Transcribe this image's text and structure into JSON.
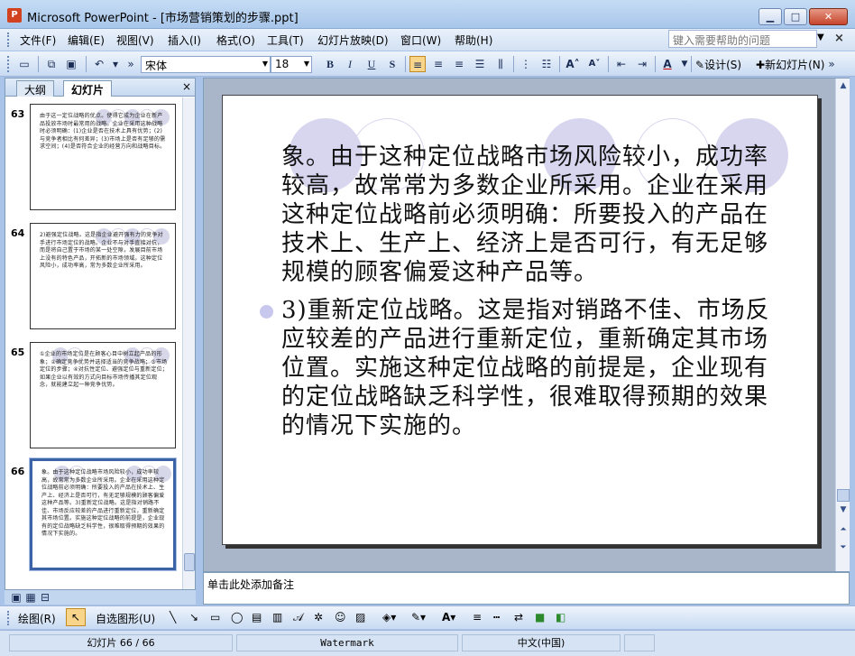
{
  "window": {
    "app_icon": "P",
    "title": "Microsoft PowerPoint - [市场营销策划的步骤.ppt]"
  },
  "window_controls": {
    "minimize": "▁",
    "maximize": "□",
    "close": "✕"
  },
  "menu": {
    "items": [
      "文件(F)",
      "编辑(E)",
      "视图(V)",
      "插入(I)",
      "格式(O)",
      "工具(T)",
      "幻灯片放映(D)",
      "窗口(W)",
      "帮助(H)"
    ],
    "help_placeholder": "键入需要帮助的问题"
  },
  "toolbar": {
    "font": "宋体",
    "size": "18",
    "bold": "B",
    "italic": "I",
    "underline": "U",
    "shadow": "S",
    "design": "设计(S)",
    "new_slide": "新幻灯片(N)"
  },
  "left_pane": {
    "tabs": [
      "大纲",
      "幻灯片"
    ],
    "close": "×",
    "thumbnails": [
      {
        "number": "63",
        "text": "由于这一定位战略的优点。使得它成为企业在新产品投放市场时最常用的战略。企业在采用这种战略时必须明确：(1)企业是否在技术上具有优势；(2)与竞争者相比有何差异；(3)市场上是否有足够的需求空间；(4)是否符合企业的经营方向和战略目标。"
      },
      {
        "number": "64",
        "text": "2)避强定位战略。这是指企业避开强有力的竞争对手进行市场定位的战略。企业不与对手直接对抗，而是将自己置于市场的某一处空隙，发展目前市场上没有的特色产品，开拓新的市场领域。这种定位风险小，成功率高，常为多数企业所采用。"
      },
      {
        "number": "65",
        "text": "①企业的市场定位是在顾客心目中树立起产品的形象；②确定竞争优势并选择适当的竞争战略；③市场定位的步骤；④对抗性定位、避强定位与重新定位；如果企业以有效的方式向目标市场传播其定位观念，就能建立起一种竞争优势。"
      },
      {
        "number": "66",
        "text": "象。由于这种定位战略市场风险较小，成功率较高，故常常为多数企业所采用。企业在采用这种定位战略前必须明确：所要投入的产品在技术上、生产上、经济上是否可行，有无足够规模的顾客偏爱这种产品等。3)重新定位战略。这是指对销路不佳、市场反应较差的产品进行重新定位，重新确定其市场位置。实施这种定位战略的前提是，企业现有的定位战略缺乏科学性，很难取得预期的效果的情况下实施的。"
      }
    ]
  },
  "slide": {
    "paragraph1": "象。由于这种定位战略市场风险较小，成功率较高，故常常为多数企业所采用。企业在采用这种定位战略前必须明确：所要投入的产品在技术上、生产上、经济上是否可行，有无足够规模的顾客偏爱这种产品等。",
    "paragraph2": "3)重新定位战略。这是指对销路不佳、市场反应较差的产品进行重新定位，重新确定其市场位置。实施这种定位战略的前提是，企业现有的定位战略缺乏科学性，很难取得预期的效果的情况下实施的。"
  },
  "notes": {
    "placeholder": "单击此处添加备注"
  },
  "drawing_toolbar": {
    "draw": "绘图(R)",
    "autoshapes": "自选图形(U)"
  },
  "status": {
    "slide": "幻灯片 66 / 66",
    "theme": "Watermark",
    "language": "中文(中国)"
  },
  "colors": {
    "accent": "#3b63a6",
    "bullet": "#c8c8ee",
    "decor_circle": "#d8d6ee"
  }
}
